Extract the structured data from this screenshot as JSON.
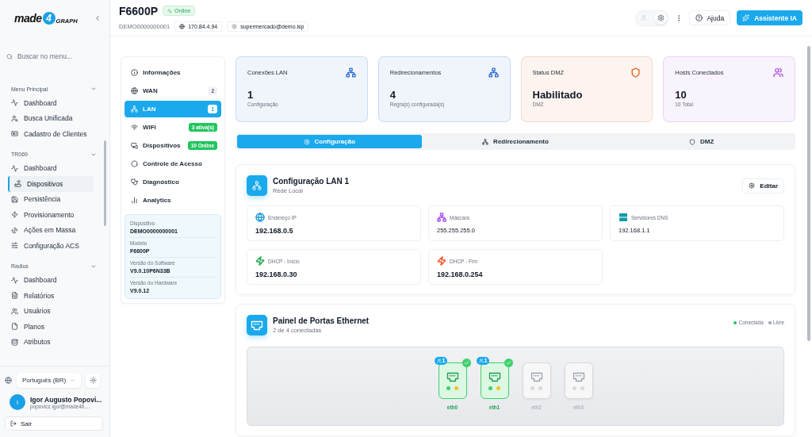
{
  "sidebar": {
    "logo": {
      "word": "made",
      "digit": "4",
      "tag": "GRAPH"
    },
    "search": {
      "placeholder": "Buscar no menu..."
    },
    "sections": [
      {
        "title": "Menu Principal",
        "expanded": true,
        "items": [
          {
            "label": "Dashboard",
            "selected": false
          },
          {
            "label": "Busca Unificada",
            "selected": false
          },
          {
            "label": "Cadastro de Clientes",
            "selected": false
          }
        ]
      },
      {
        "title": "TR069",
        "expanded": true,
        "items": [
          {
            "label": "Dashboard",
            "selected": false
          },
          {
            "label": "Dispositivos",
            "selected": true
          },
          {
            "label": "Persistência",
            "selected": false
          },
          {
            "label": "Provisionamento",
            "selected": false
          },
          {
            "label": "Ações em Massa",
            "selected": false
          },
          {
            "label": "Configuração ACS",
            "selected": false
          }
        ]
      },
      {
        "title": "Radius",
        "expanded": true,
        "items": [
          {
            "label": "Dashboard",
            "selected": false
          },
          {
            "label": "Relatórios",
            "selected": false
          },
          {
            "label": "Usuários",
            "selected": false
          },
          {
            "label": "Planos",
            "selected": false
          },
          {
            "label": "Atributos",
            "selected": false
          }
        ]
      }
    ],
    "language": "Português (BR)",
    "user": {
      "initial": "I",
      "name": "Igor Augusto Popovi...",
      "email": "popovicz.igor@made4it...."
    },
    "logout": "Sair"
  },
  "header": {
    "title": "F6600P",
    "status": "Online",
    "serial": "DEMO0000000001",
    "ip": "170.84.4.94",
    "email": "supermercado@demo.isp",
    "view_toggle": [
      {
        "selected": false
      },
      {
        "selected": true
      }
    ],
    "help": "Ajuda",
    "assistant": "Assistente IA"
  },
  "device_menu": {
    "items": [
      {
        "label": "Informações",
        "selected": false
      },
      {
        "label": "WAN",
        "selected": false,
        "badge": "2",
        "badge_highlight": false
      },
      {
        "label": "LAN",
        "selected": true,
        "badge": "1",
        "badge_highlight": false
      },
      {
        "label": "WiFi",
        "selected": false,
        "badge": "3 ativa(s)",
        "badge_highlight": true
      },
      {
        "label": "Dispositivos",
        "selected": false,
        "badge": "10 Online",
        "badge_highlight": true
      },
      {
        "label": "Controle de Acesso",
        "selected": false
      },
      {
        "label": "Diagnóstico",
        "selected": false
      },
      {
        "label": "Analytics",
        "selected": false
      }
    ],
    "details": [
      {
        "label": "Dispositivo",
        "value": "DEMO0000000001"
      },
      {
        "label": "Modelo",
        "value": "F6600P"
      },
      {
        "label": "Versão do Software",
        "value": "V9.0.10P6N33B"
      },
      {
        "label": "Versão do Hardware",
        "value": "V9.0.12"
      }
    ]
  },
  "stats": [
    {
      "title": "Conexões LAN",
      "value": "1",
      "caption": "Configuração",
      "color": "#2f6fd6"
    },
    {
      "title": "Redirecionamentos",
      "value": "4",
      "caption": "Regra(s) configurada(s)",
      "color": "#2f6fd6"
    },
    {
      "title": "Status DMZ",
      "value": "Habilitado",
      "caption": "DMZ",
      "color": "#e8692a"
    },
    {
      "title": "Hosts Conectados",
      "value": "10",
      "caption": "10 Total",
      "color": "#b05be0"
    }
  ],
  "tabs": [
    {
      "label": "Configuração",
      "selected": true
    },
    {
      "label": "Redirecionamento",
      "selected": false
    },
    {
      "label": "DMZ",
      "selected": false
    }
  ],
  "lan_config": {
    "title": "Configuração LAN 1",
    "subtitle": "Rede Local",
    "action": "Editar",
    "fields": [
      {
        "label": "Endereço IP",
        "value": "192.168.0.5",
        "bold": true,
        "color": "#2a9fd8"
      },
      {
        "label": "Máscara",
        "value": "255.255.255.0",
        "bold": false,
        "color": "#a855f7"
      },
      {
        "label": "Servidores DNS",
        "value": "192.168.1.1",
        "bold": false,
        "color": "#0f9aa8"
      },
      {
        "label": "DHCP - Início",
        "value": "192.168.0.30",
        "bold": true,
        "color": "#22a855"
      },
      {
        "label": "DHCP - Fim",
        "value": "192.168.0.254",
        "bold": true,
        "color": "#ef5a2a"
      }
    ]
  },
  "ports_panel": {
    "title": "Painel de Portas Ethernet",
    "subtitle": "2 de 4 conectadas",
    "legend": [
      {
        "label": "Conectada",
        "color": "#22c55e"
      },
      {
        "label": "Livre",
        "color": "#9ca3af"
      }
    ],
    "ports": [
      {
        "name": "eth0",
        "connected": true,
        "hosts": "1"
      },
      {
        "name": "eth1",
        "connected": true,
        "hosts": "1"
      },
      {
        "name": "eth2",
        "connected": false
      },
      {
        "name": "eth3",
        "connected": false
      }
    ]
  }
}
